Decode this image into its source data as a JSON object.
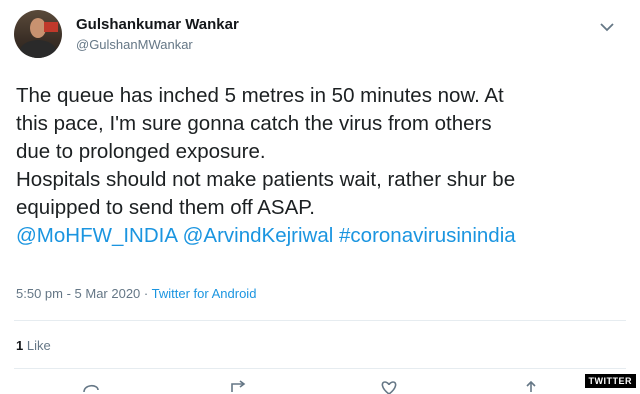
{
  "tweet": {
    "author_name": "Gulshankumar Wankar",
    "author_handle": "@GulshanMWankar",
    "text_lines": [
      "The queue has inched 5 metres in 50 minutes now. At",
      "this pace, I'm sure gonna catch the virus from others",
      "due to prolonged exposure.",
      "Hospitals should not make patients wait, rather shur be",
      "equipped to send them off ASAP."
    ],
    "mentions": [
      "@MoHFW_INDIA",
      "@ArvindKejriwal",
      "#coronavirusinindia"
    ],
    "timestamp": "5:50 pm - 5 Mar 2020",
    "separator": "·",
    "source": "Twitter for Android",
    "like_count": "1",
    "like_label": "Like"
  },
  "watermark": "TWITTER",
  "colors": {
    "link": "#1b95e0",
    "meta": "#657786",
    "text": "#1c2022"
  },
  "icons": [
    "chevron-down-icon",
    "reply-icon",
    "retweet-icon",
    "like-icon",
    "share-icon"
  ]
}
